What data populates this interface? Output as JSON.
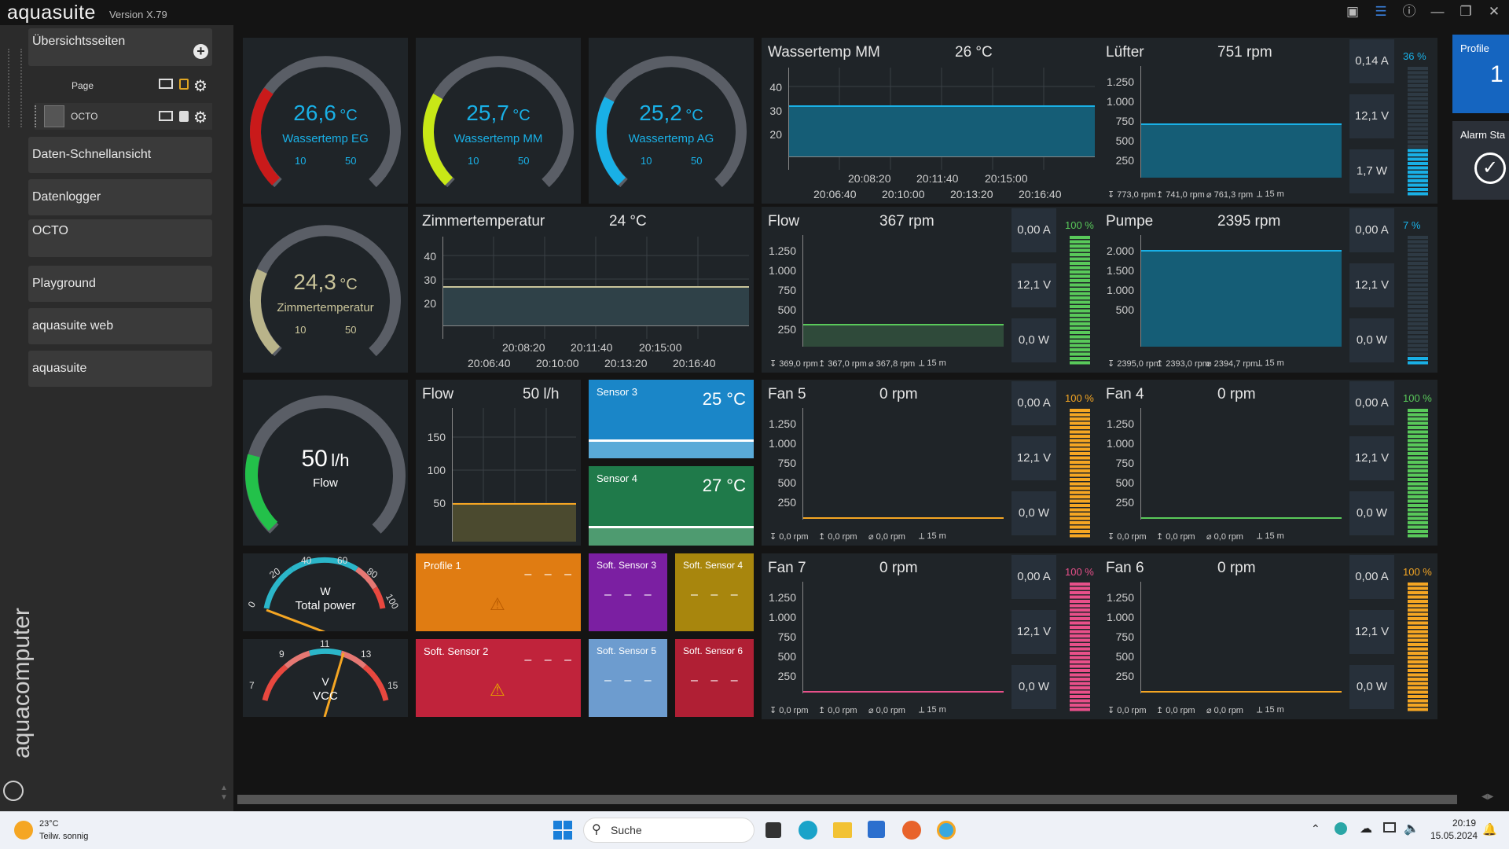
{
  "app": {
    "name": "aquasuite",
    "version": "Version X.79"
  },
  "sidebar": {
    "overview_label": "Übersichtsseiten",
    "page_label": "Page",
    "octo_label": "OCTO",
    "items": [
      "Daten-Schnellansicht",
      "Datenlogger",
      "OCTO",
      "Playground",
      "aquasuite web",
      "aquasuite"
    ],
    "vertical_brand": "aquacomputer"
  },
  "gauges": [
    {
      "value": "26,6",
      "unit": "°C",
      "label": "Wassertemp EG",
      "min": "10",
      "max": "50",
      "color": "#c91a1a",
      "fill": 0.3
    },
    {
      "value": "25,7",
      "unit": "°C",
      "label": "Wassertemp MM",
      "min": "10",
      "max": "50",
      "color": "#c8e816",
      "fill": 0.28
    },
    {
      "value": "25,2",
      "unit": "°C",
      "label": "Wassertemp AG",
      "min": "10",
      "max": "50",
      "color": "#19b0e6",
      "fill": 0.27
    },
    {
      "value": "24,3",
      "unit": "°C",
      "label": "Zimmertemperatur",
      "min": "10",
      "max": "50",
      "color": "#b9b48a",
      "fill": 0.26
    },
    {
      "value": "50",
      "unit": "l/h",
      "label": "Flow",
      "min": "",
      "max": "",
      "color": "#23c14a",
      "fill": 0.22
    }
  ],
  "charts": {
    "wassertemp_mm": {
      "title": "Wassertemp MM",
      "value": "26 °C",
      "yticks": [
        "40",
        "30",
        "20"
      ],
      "xticks_top": [
        "20:08:20",
        "20:11:40",
        "20:15:00"
      ],
      "xticks_bottom": [
        "20:06:40",
        "20:10:00",
        "20:13:20",
        "20:16:40"
      ]
    },
    "zimmertemperatur": {
      "title": "Zimmertemperatur",
      "value": "24 °C",
      "yticks": [
        "40",
        "30",
        "20"
      ],
      "xticks_top": [
        "20:08:20",
        "20:11:40",
        "20:15:00"
      ],
      "xticks_bottom": [
        "20:06:40",
        "20:10:00",
        "20:13:20",
        "20:16:40"
      ]
    },
    "flow_lh": {
      "title": "Flow",
      "value": "50 l/h",
      "yticks": [
        "150",
        "100",
        "50"
      ]
    }
  },
  "fan_panels": [
    {
      "id": "luefter",
      "title": "Lüfter",
      "rpm": "751 rpm",
      "pct": "36 %",
      "pct_color": "#19b0e6",
      "current": "0,14 A",
      "voltage": "12,1 V",
      "power": "1,7 W",
      "yticks": [
        "1.250",
        "1.000",
        "750",
        "500",
        "250"
      ],
      "foot": [
        "↧ 773,0 rpm",
        "↥ 741,0 rpm",
        "⌀ 761,3 rpm",
        "⟂ 15 m"
      ],
      "line_color": "#19b0e6",
      "level": 0.36
    },
    {
      "id": "flow",
      "title": "Flow",
      "rpm": "367 rpm",
      "pct": "100 %",
      "pct_color": "#59c95a",
      "current": "0,00 A",
      "voltage": "12,1 V",
      "power": "0,0 W",
      "yticks": [
        "1.250",
        "1.000",
        "750",
        "500",
        "250"
      ],
      "foot": [
        "↧ 369,0 rpm",
        "↥ 367,0 rpm",
        "⌀ 367,8 rpm",
        "⟂ 15 m"
      ],
      "line_color": "#59c95a",
      "level": 1.0
    },
    {
      "id": "pumpe",
      "title": "Pumpe",
      "rpm": "2395 rpm",
      "pct": "7 %",
      "pct_color": "#19b0e6",
      "current": "0,00 A",
      "voltage": "12,1 V",
      "power": "0,0 W",
      "yticks": [
        "2.000",
        "1.500",
        "1.000",
        "500"
      ],
      "foot": [
        "↧ 2395,0 rpm",
        "↥ 2393,0 rpm",
        "⌀ 2394,7 rpm",
        "⟂ 15 m"
      ],
      "line_color": "#19b0e6",
      "level": 0.07
    },
    {
      "id": "fan5",
      "title": "Fan 5",
      "rpm": "0 rpm",
      "pct": "100 %",
      "pct_color": "#f5a623",
      "current": "0,00 A",
      "voltage": "12,1 V",
      "power": "0,0 W",
      "yticks": [
        "1.250",
        "1.000",
        "750",
        "500",
        "250"
      ],
      "foot": [
        "↧ 0,0 rpm",
        "↥ 0,0 rpm",
        "⌀ 0,0 rpm",
        "⟂ 15 m"
      ],
      "line_color": "#f5a623",
      "level": 1.0
    },
    {
      "id": "fan4",
      "title": "Fan 4",
      "rpm": "0 rpm",
      "pct": "100 %",
      "pct_color": "#59c95a",
      "current": "0,00 A",
      "voltage": "12,1 V",
      "power": "0,0 W",
      "yticks": [
        "1.250",
        "1.000",
        "750",
        "500",
        "250"
      ],
      "foot": [
        "↧ 0,0 rpm",
        "↥ 0,0 rpm",
        "⌀ 0,0 rpm",
        "⟂ 15 m"
      ],
      "line_color": "#59c95a",
      "level": 1.0
    },
    {
      "id": "fan7",
      "title": "Fan 7",
      "rpm": "0 rpm",
      "pct": "100 %",
      "pct_color": "#e8508a",
      "current": "0,00 A",
      "voltage": "12,1 V",
      "power": "0,0 W",
      "yticks": [
        "1.250",
        "1.000",
        "750",
        "500",
        "250"
      ],
      "foot": [
        "↧ 0,0 rpm",
        "↥ 0,0 rpm",
        "⌀ 0,0 rpm",
        "⟂ 15 m"
      ],
      "line_color": "#e8508a",
      "level": 1.0
    },
    {
      "id": "fan6",
      "title": "Fan 6",
      "rpm": "0 rpm",
      "pct": "100 %",
      "pct_color": "#f5a623",
      "current": "0,00 A",
      "voltage": "12,1 V",
      "power": "0,0 W",
      "yticks": [
        "1.250",
        "1.000",
        "750",
        "500",
        "250"
      ],
      "foot": [
        "↧ 0,0 rpm",
        "↥ 0,0 rpm",
        "⌀ 0,0 rpm",
        "⟂ 15 m"
      ],
      "line_color": "#f5a623",
      "level": 1.0
    }
  ],
  "sensors": {
    "sensor3": {
      "label": "Sensor 3",
      "value": "25 °C",
      "color": "#1a86c8"
    },
    "sensor4": {
      "label": "Sensor 4",
      "value": "27 °C",
      "color": "#1f7a4a"
    },
    "profile1": {
      "label": "Profile 1",
      "value": "– – –",
      "color": "#e07c12"
    },
    "soft2": {
      "label": "Soft. Sensor 2",
      "value": "– – –",
      "color": "#c0233b"
    },
    "soft3": {
      "label": "Soft. Sensor 3",
      "value": "– – –",
      "color": "#7b1fa2"
    },
    "soft4": {
      "label": "Soft. Sensor 4",
      "value": "– – –",
      "color": "#a8860d"
    },
    "soft5": {
      "label": "Soft. Sensor 5",
      "value": "– – –",
      "color": "#6d9ccf"
    },
    "soft6": {
      "label": "Soft. Sensor 6",
      "value": "– – –",
      "color": "#b01f34"
    }
  },
  "power_gauge": {
    "unit": "W",
    "label": "Total power",
    "ticks": [
      "0",
      "20",
      "40",
      "60",
      "80",
      "100"
    ]
  },
  "volt_gauge": {
    "unit": "V",
    "label": "VCC",
    "ticks": [
      "7",
      "9",
      "11",
      "13",
      "15"
    ]
  },
  "right_column": {
    "profile_label": "Profile",
    "profile_value": "1",
    "alarm_label": "Alarm Sta"
  },
  "watermark": "aquasuite",
  "taskbar": {
    "weather_temp": "23°C",
    "weather_desc": "Teilw. sonnig",
    "search_placeholder": "Suche",
    "time": "20:19",
    "date": "15.05.2024"
  }
}
